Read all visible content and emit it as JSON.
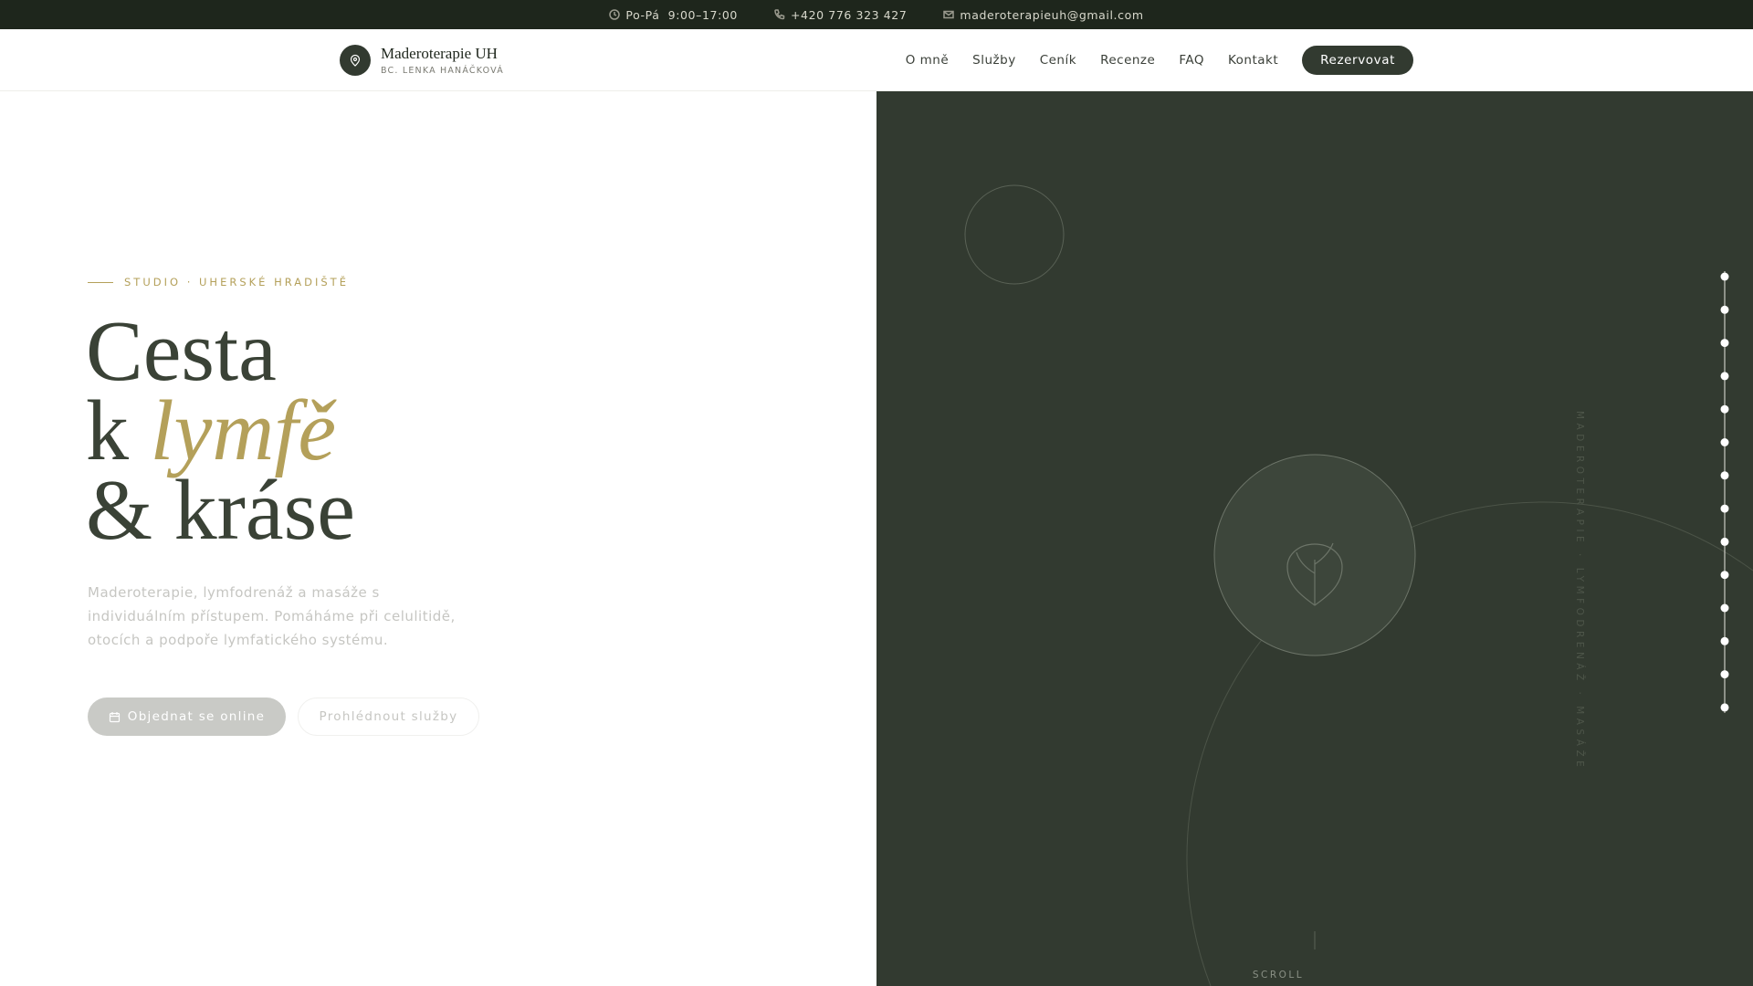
{
  "topbar": {
    "hours": "Po-Pá  9:00–17:00",
    "phone": "+420 776 323 427",
    "email": "maderoterapieuh@gmail.com"
  },
  "brand": {
    "name": "Maderoterapie UH",
    "subtitle": "BC. LENKA HANÁČKOVÁ"
  },
  "nav": {
    "items": [
      "O mně",
      "Služby",
      "Ceník",
      "Recenze",
      "FAQ",
      "Kontakt"
    ],
    "cta": "Rezervovat"
  },
  "hero": {
    "eyebrow": "STUDIO · UHERSKÉ HRADIŠTĚ",
    "line1": "Cesta",
    "line2_prefix": "k ",
    "line2_accent": "lymfě",
    "line3": "& kráse",
    "lead": "Maderoterapie, lymfodrenáž a masáže s individuálním přístupem. Pomáháme při celulitidě, otocích a podpoře lymfatického systému.",
    "primary_button": "Objednat se online",
    "secondary_button": "Prohlédnout služby"
  },
  "panel": {
    "vertical_text": "MADEROTERAPIE · LYMFODRENÁŽ · MASÁŽE",
    "scroll_label": "SCROLL",
    "dot_count": 14
  },
  "colors": {
    "dark": "#323a30",
    "topbar": "#1e261c",
    "gold": "#b4a05a"
  }
}
